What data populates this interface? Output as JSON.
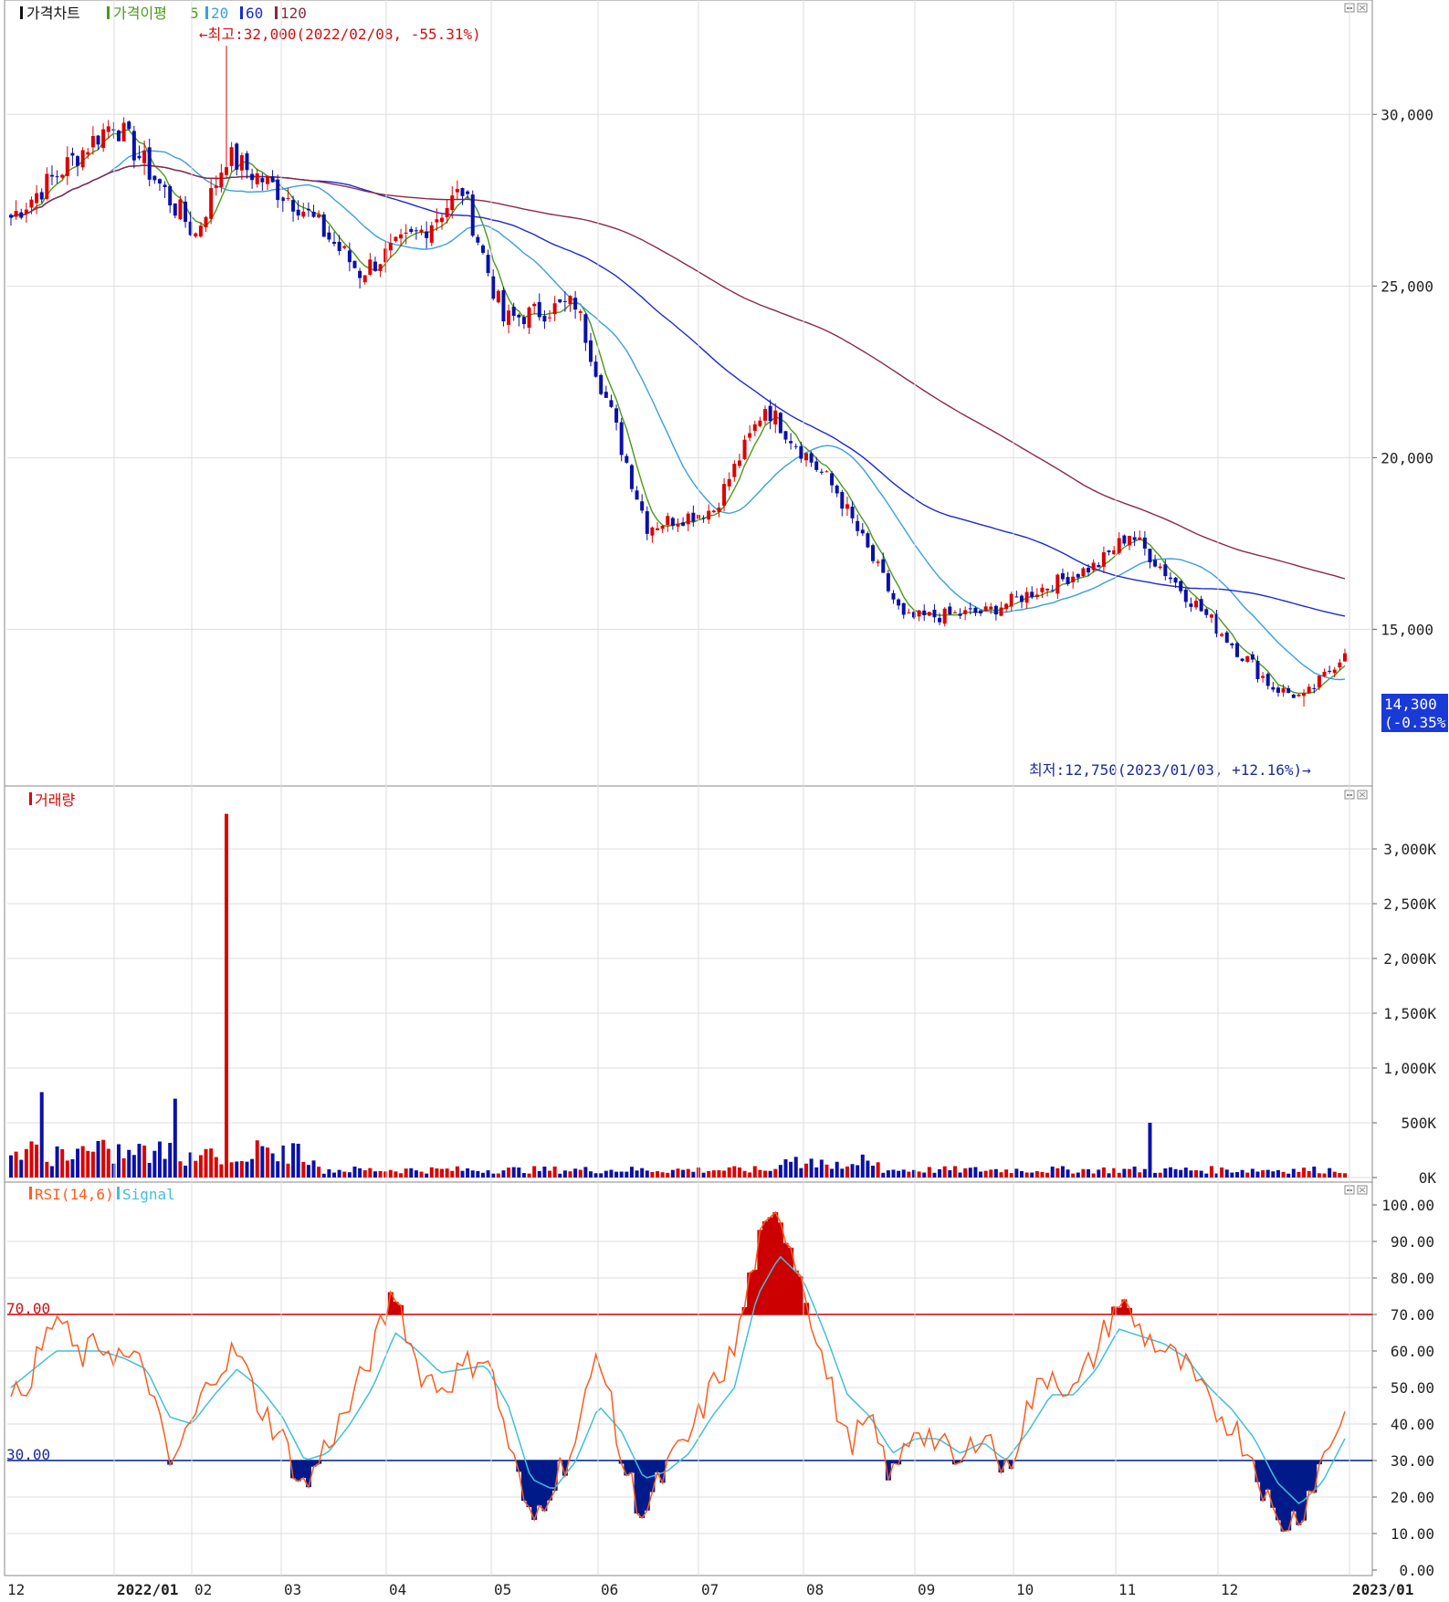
{
  "colors": {
    "up": "#dd0000",
    "down": "#0a10a8",
    "ma5": "#4a9a1a",
    "ma20": "#3aa0dc",
    "ma60": "#1a2ad0",
    "ma120": "#8a2a44",
    "grid": "#dedede",
    "rsi": "#ff5a1e",
    "signal": "#40c0d8",
    "overbought": "#cc0000",
    "oversold": "#001a8a"
  },
  "panels": {
    "price": {
      "legend": {
        "title": "가격차트",
        "ma_label": "가격이평",
        "p5": "5",
        "p20": "20",
        "p60": "60",
        "p120": "120"
      },
      "high_note": "←최고:32,000(2022/02/08, -55.31%)",
      "low_note": "최저:12,750(2023/01/03, +12.16%)→",
      "last_price": "14,300",
      "last_change": "(-0.35%)"
    },
    "volume": {
      "legend": "거래량"
    },
    "rsi": {
      "legend": "RSI(14,6)",
      "signal": "Signal",
      "upper_label": "70.00",
      "lower_label": "30.00"
    }
  },
  "x_axis_labels": [
    "12",
    "2022/01",
    "02",
    "03",
    "04",
    "05",
    "06",
    "07",
    "08",
    "09",
    "10",
    "11",
    "12",
    "2023/01"
  ],
  "chart_data": [
    {
      "type": "candlestick",
      "title": "가격차트",
      "ylim": [
        11500,
        32800
      ],
      "yticks": [
        "15,000",
        "20,000",
        "25,000",
        "30,000"
      ],
      "overlays": [
        "5",
        "20",
        "60",
        "120"
      ],
      "anchors": [
        {
          "date": "2021/12",
          "close": 27000
        },
        {
          "date": "2022/01 mid",
          "close": 29800
        },
        {
          "date": "2022/01 end",
          "close": 26500
        },
        {
          "date": "2022/02/08",
          "high": 32000,
          "close": 28800
        },
        {
          "date": "2022/02 end",
          "close": 27400
        },
        {
          "date": "2022/03 mid",
          "close": 25400
        },
        {
          "date": "2022/04",
          "close": 26600
        },
        {
          "date": "2022/04 end",
          "close": 27800
        },
        {
          "date": "2022/05 mid",
          "close": 24000
        },
        {
          "date": "2022/06",
          "close": 24500
        },
        {
          "date": "2022/06 end",
          "close": 18000
        },
        {
          "date": "2022/07",
          "close": 18500
        },
        {
          "date": "2022/08",
          "close": 21500
        },
        {
          "date": "2022/09",
          "close": 19000
        },
        {
          "date": "2022/10",
          "close": 15300
        },
        {
          "date": "2022/11",
          "close": 15500
        },
        {
          "date": "2022/11 end",
          "close": 16900
        },
        {
          "date": "2022/12 start",
          "close": 17800
        },
        {
          "date": "2022/12 end",
          "close": 13300
        },
        {
          "date": "2023/01/03",
          "low": 12750,
          "close": 13000
        },
        {
          "date": "2023/01",
          "close": 14300
        }
      ]
    },
    {
      "type": "bar",
      "title": "거래량",
      "ylim": [
        0,
        3500000
      ],
      "yticks": [
        "0K",
        "500K",
        "1,000K",
        "1,500K",
        "2,000K",
        "2,500K",
        "3,000K"
      ],
      "spikes": [
        {
          "date": "2021/12",
          "value": 780000
        },
        {
          "date": "2022/01",
          "value": 720000
        },
        {
          "date": "2022/02/08",
          "value": 3320000
        },
        {
          "date": "2022/11 end",
          "value": 500000
        }
      ],
      "typical_value": 70000
    },
    {
      "type": "line",
      "title": "RSI(14,6)",
      "ylim": [
        0,
        100
      ],
      "yticks": [
        "0.00",
        "10.00",
        "20.00",
        "30.00",
        "40.00",
        "50.00",
        "60.00",
        "70.00",
        "80.00",
        "90.00",
        "100.00"
      ],
      "thresholds": [
        70,
        30
      ],
      "series": [
        {
          "name": "RSI(14,6)",
          "values": [
            45,
            55,
            70,
            58,
            62,
            58,
            55,
            28,
            40,
            55,
            60,
            45,
            36,
            22,
            35,
            45,
            60,
            77,
            55,
            50,
            55,
            60,
            35,
            12,
            25,
            35,
            62,
            30,
            15,
            28,
            36,
            50,
            60,
            88,
            98,
            80,
            55,
            35,
            40,
            25,
            40,
            35,
            28,
            40,
            26,
            45,
            55,
            48,
            60,
            74,
            65,
            60,
            55,
            45,
            40,
            30,
            12,
            15,
            30,
            44
          ]
        },
        {
          "name": "Signal",
          "values": [
            50,
            55,
            60,
            60,
            60,
            58,
            55,
            42,
            40,
            48,
            55,
            50,
            42,
            30,
            32,
            40,
            50,
            65,
            60,
            54,
            55,
            56,
            45,
            25,
            22,
            30,
            45,
            38,
            25,
            27,
            32,
            42,
            50,
            75,
            86,
            80,
            65,
            48,
            42,
            32,
            36,
            36,
            32,
            35,
            30,
            38,
            48,
            48,
            55,
            66,
            64,
            62,
            58,
            50,
            44,
            36,
            24,
            18,
            24,
            36
          ]
        }
      ]
    }
  ]
}
